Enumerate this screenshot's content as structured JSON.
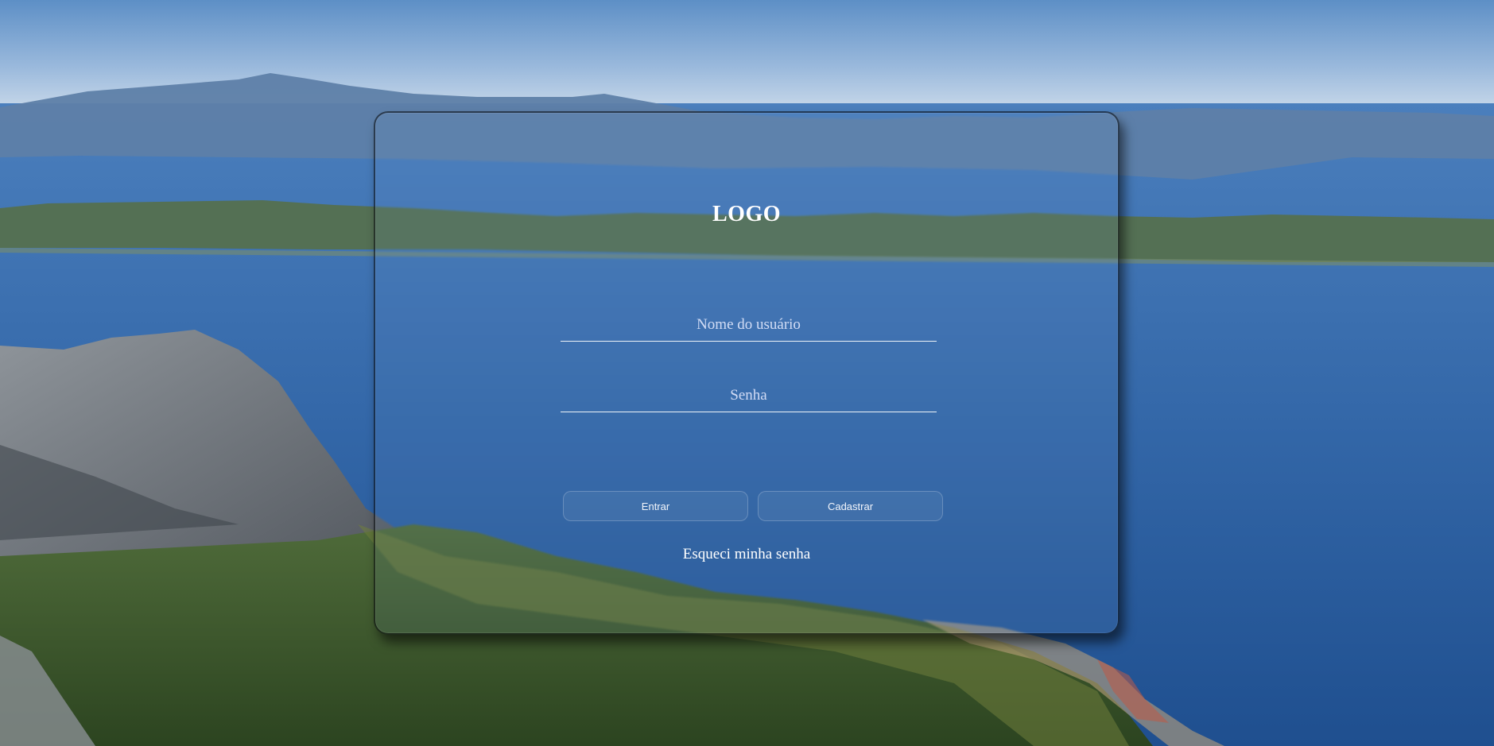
{
  "login": {
    "logo_text": "LOGO",
    "username_placeholder": "Nome do usuário",
    "password_placeholder": "Senha",
    "username_value": "",
    "password_value": "",
    "enter_label": "Entrar",
    "register_label": "Cadastrar",
    "forgot_label": "Esqueci minha senha"
  },
  "colors": {
    "text": "#ffffff",
    "input_underline": "#ffffff",
    "sea": "#2f62a3",
    "sky": "#a9c6e4"
  }
}
